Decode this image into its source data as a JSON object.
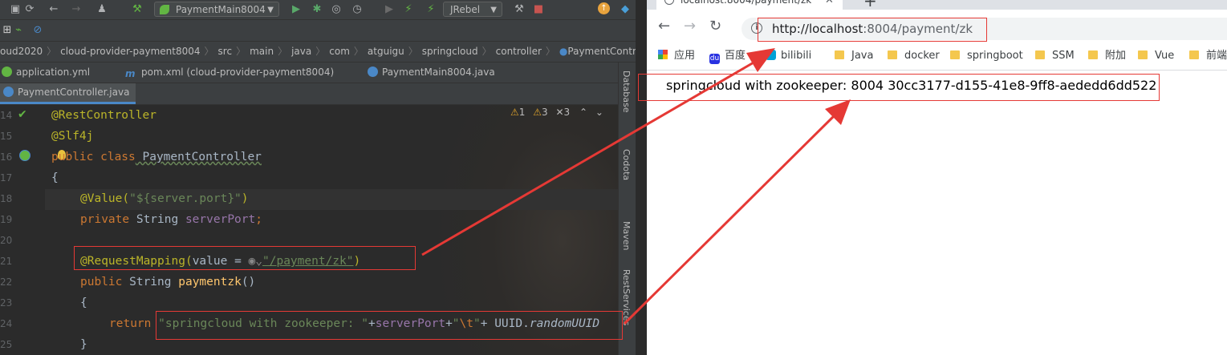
{
  "ide": {
    "run_config": "PaymentMain8004",
    "jrebel": "JRebel",
    "breadcrumb": [
      "oud2020",
      "cloud-provider-payment8004",
      "src",
      "main",
      "java",
      "com",
      "atguigu",
      "springcloud",
      "controller",
      "PaymentControlle"
    ],
    "tabs_row1": [
      {
        "label": "application.yml"
      },
      {
        "label": "pom.xml (cloud-provider-payment8004)"
      },
      {
        "label": "PaymentMain8004.java"
      }
    ],
    "active_tab": "PaymentController.java",
    "inspections": {
      "warn1": "1",
      "warn2": "3",
      "warn3": "3"
    },
    "side_panels": [
      "Database",
      "Codota",
      "Maven",
      "RestServices"
    ],
    "line_numbers": [
      "14",
      "15",
      "16",
      "17",
      "18",
      "19",
      "20",
      "21",
      "22",
      "23",
      "24",
      "25"
    ],
    "code": {
      "l14": "@RestController",
      "l15": "@Slf4j",
      "l16_kw": "public class",
      "l16_name": " PaymentController",
      "l17": "{",
      "l18_ann": "@Value(",
      "l18_str": "\"${server.port}\"",
      "l18_end": ")",
      "l19_kw": "private",
      "l19_type": " String ",
      "l19_field": "serverPort",
      "l19_end": ";",
      "l21_ann": "@RequestMapping(",
      "l21_attr": "value = ",
      "l21_str": "\"/payment/zk\"",
      "l21_end": ")",
      "l22_kw": "public",
      "l22_type": " String ",
      "l22_fn": "paymentzk",
      "l22_end": "()",
      "l23": "{",
      "l24_kw": "return ",
      "l24_str1": "\"springcloud with zookeeper: \"",
      "l24_plus1": "+",
      "l24_field": "serverPort",
      "l24_plus2": "+",
      "l24_str2a": "\"",
      "l24_esc": "\\t",
      "l24_str2b": "\"",
      "l24_plus3": "+ UUID.",
      "l24_call": "randomUUID",
      "l25": "}"
    }
  },
  "browser": {
    "tab_title": "localhost:8004/payment/zk",
    "new_tab": "+",
    "url_host": "http://localhost",
    "url_rest": ":8004/payment/zk",
    "bookmarks": [
      "应用",
      "百度",
      "bilibili",
      "Java",
      "docker",
      "springboot",
      "SSM",
      "附加",
      "Vue",
      "前端框架"
    ],
    "page_text": "springcloud with zookeeper: 8004 30cc3177-d155-41e8-9ff8-aededd6dd522"
  },
  "annotation_color": "#e53935"
}
